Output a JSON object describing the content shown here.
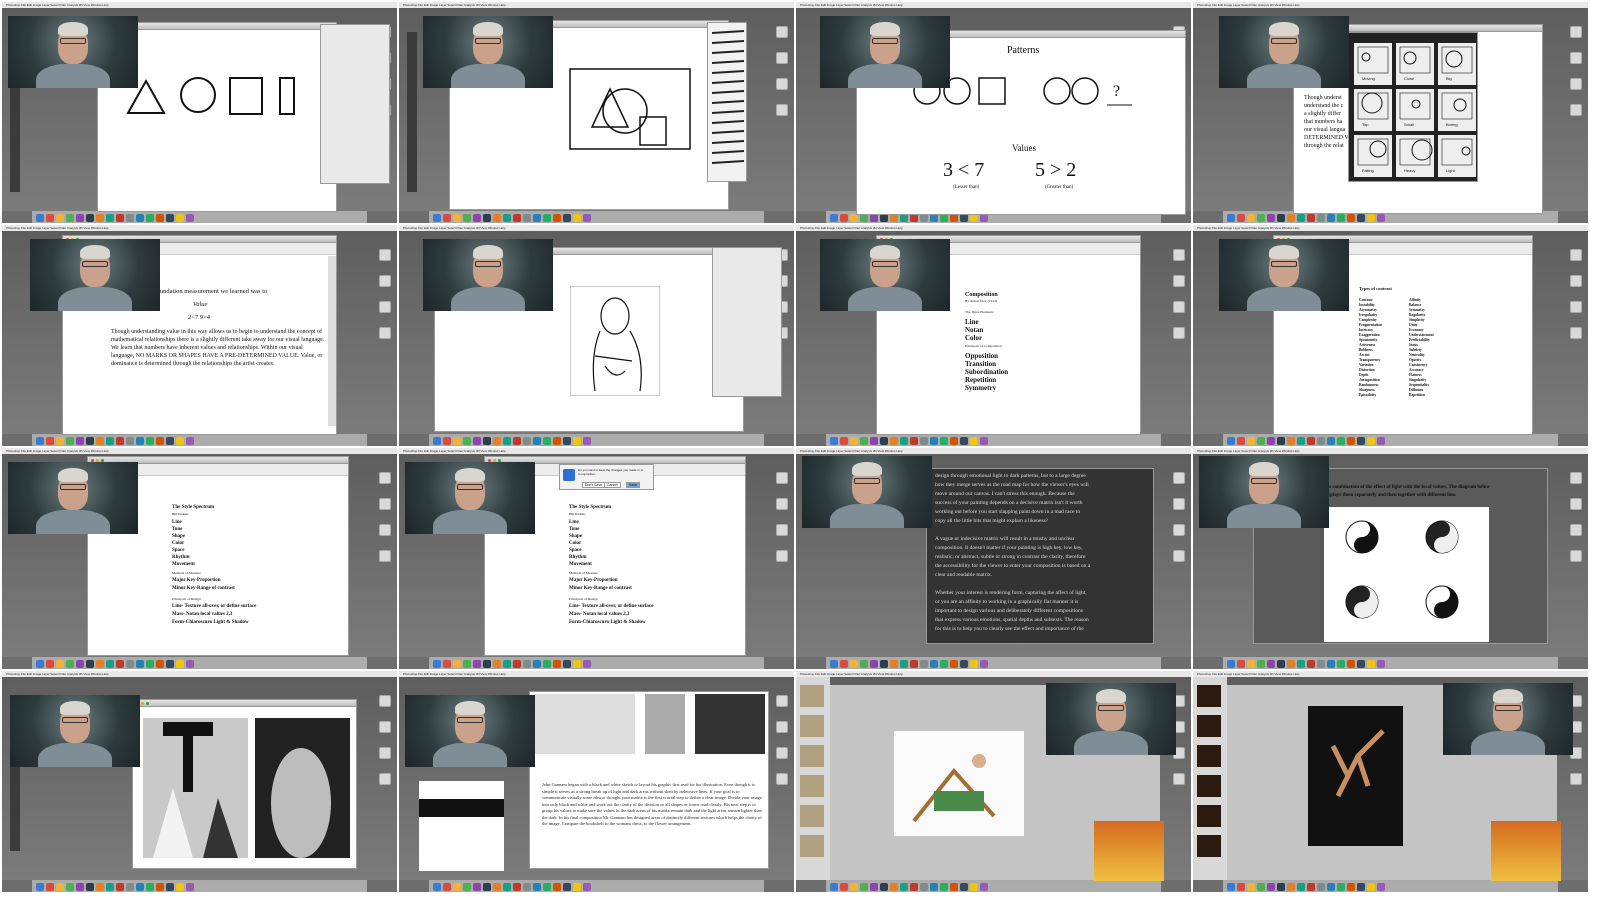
{
  "menu": {
    "app": "Photoshop",
    "items": [
      "File",
      "Edit",
      "Image",
      "Layer",
      "Select",
      "Filter",
      "Analysis",
      "3D",
      "View",
      "Window",
      "Help"
    ]
  },
  "panels": {
    "patterns": {
      "title": "Patterns",
      "values_title": "Values",
      "ineq1": "3 < 7",
      "ineq2": "5 > 2",
      "lesser": "(Lesser than)",
      "greater": "(Greater than)",
      "q": "?"
    },
    "value_doc": {
      "top": "Foundation measurement we learned was to",
      "value": "Value",
      "eq": "2<7  9>4",
      "para": "Though understanding value in this way allows us to begin to understand the concept of mathematical relationships there is a slightly different take away for our visual language. We learn that numbers have inherent values and relationships. Within our visual language, NO MARKS OR SHAPES HAVE A PRE-DETERMINED VALUE. Value, or dominance is determined through the relationships the artist creates."
    },
    "partial": [
      "Though underst",
      "understand the c",
      "a slightly differ",
      "that numbers ha",
      "our visual langua",
      "DETERMINED VA",
      "through the relat"
    ],
    "thumbs": [
      "Moving",
      "Close",
      "Big",
      "Top",
      "Small",
      "Boring",
      "Falling",
      "Heavy",
      "Light"
    ],
    "composition": {
      "title": "Composition",
      "byline": "By Arthur Dow (1913)",
      "sub": "The Three Elements",
      "e1": "Line",
      "e2": "Notan",
      "e3": "Color",
      "sub2": "Principals of Composition",
      "p1": "Opposition",
      "p2": "Transition",
      "p3": "Subordination",
      "p4": "Repetition",
      "p5": "Symmetry"
    },
    "contrast": {
      "title": "Types of contrast",
      "col1": [
        "Contrast",
        "Instability",
        "Asymmetry",
        "Irregularity",
        "Complexity",
        "Fragmentation",
        "Intricacy",
        "Exaggeration",
        "Spontaneity",
        "Activeness",
        "Boldness",
        "Accent",
        "Transparency",
        "Variation",
        "Distortion",
        "Depth",
        "Juxtaposition",
        "Randomness",
        "Sharpness",
        "Episodicity"
      ],
      "col2": [
        "Affinity",
        "Balance",
        "Symmetry",
        "Regularity",
        "Simplicity",
        "Unity",
        "Economy",
        "Understatement",
        "Predictability",
        "Stasis",
        "Subtlety",
        "Neutrality",
        "Opacity",
        "Consistency",
        "Accuracy",
        "Flatness",
        "Singularity",
        "Sequentiality",
        "Diffusion",
        "Repetition"
      ]
    },
    "style": {
      "title": "The Style Spectrum",
      "by": "Bill Perkins",
      "items": [
        "Line",
        "Tone",
        "Shape",
        "Color",
        "Space",
        "Rhythm",
        "Movement"
      ],
      "sub": "Methods of Measure",
      "major": "Major Key",
      "major_s": "-Proportion",
      "minor": "Minor Key",
      "minor_s": "-Range of contrast",
      "sub2": "Principals of Design",
      "l1": "Line- Texture",
      "l1s": "all-over, or define surface",
      "l2": "Mass- Notan",
      "l2s": "local values 2,3",
      "l3": "Form-Chiaroscuro",
      "l3s": "Light & Shadow"
    },
    "dialog": {
      "msg": "Do you want to save the changes you made in 1c Composition...",
      "b1": "Don't Save",
      "b2": "Cancel",
      "b3": "Save"
    },
    "essay": [
      "design through emotional light to dark patterns, but to a large degree",
      "how they merge serves as the road map for how the viewer's eyes will",
      "move around our canvas. I can't stress this enough. Because the",
      "success of your painting depends on a decisive matrix isn't it worth",
      "working out before you start slapping paint down in a mad race to",
      "copy all the little bits that might explain a likeness?",
      "",
      "A vague or indecisive matrix will result in a mushy and unclear",
      "composition. It doesn't matter if your painting is high key, low key,",
      "realistic, or abstract, subtle or strong in contrast the clarity, therefore",
      "the accessibility for the viewer to enter your composition is based on a",
      "clear and readable matrix.",
      "",
      "Whether your interest is rendering form, capturing the affect of light,",
      "or you are an affinity to working in a graphically flat manner it is",
      "important to design various and deliberately different compositions",
      "that express various emotions, spatial depths and subtexts. The reason",
      "for this is to help you to clearly see the effect and importance of the"
    ],
    "light": [
      "is a combination of the effect of light with the local values. The diagram below",
      "displays them separately and then together with different line."
    ],
    "gannam": "John Gannam began with a black and white sketch to layout his graphic first read for his illustration. Even though it is simple it serves as a strong break up of light and dark areas without sketchy indecisive lines. If your goal is to communicate visually some idea or thought your matrix is the first crucial step to define a clear image. Divide your image into only black and white and work out the clarity of the division so all shapes or forms read clearly. His next step is to group his values to make sure the values in the dark areas of his matrix remain dark and the light areas remain lighter than the dark. In his final composition Mr. Gannam has designed areas of distinctly different textures which helps the clarity of the image. Compare the bookshelf to the womans dress, to the flower arrangement."
  },
  "colors": {
    "desktop": "#6d6d6d",
    "camera_bg": "#2d3b3f",
    "window": "#ffffff",
    "blue_fill": "#c9d6e6"
  }
}
